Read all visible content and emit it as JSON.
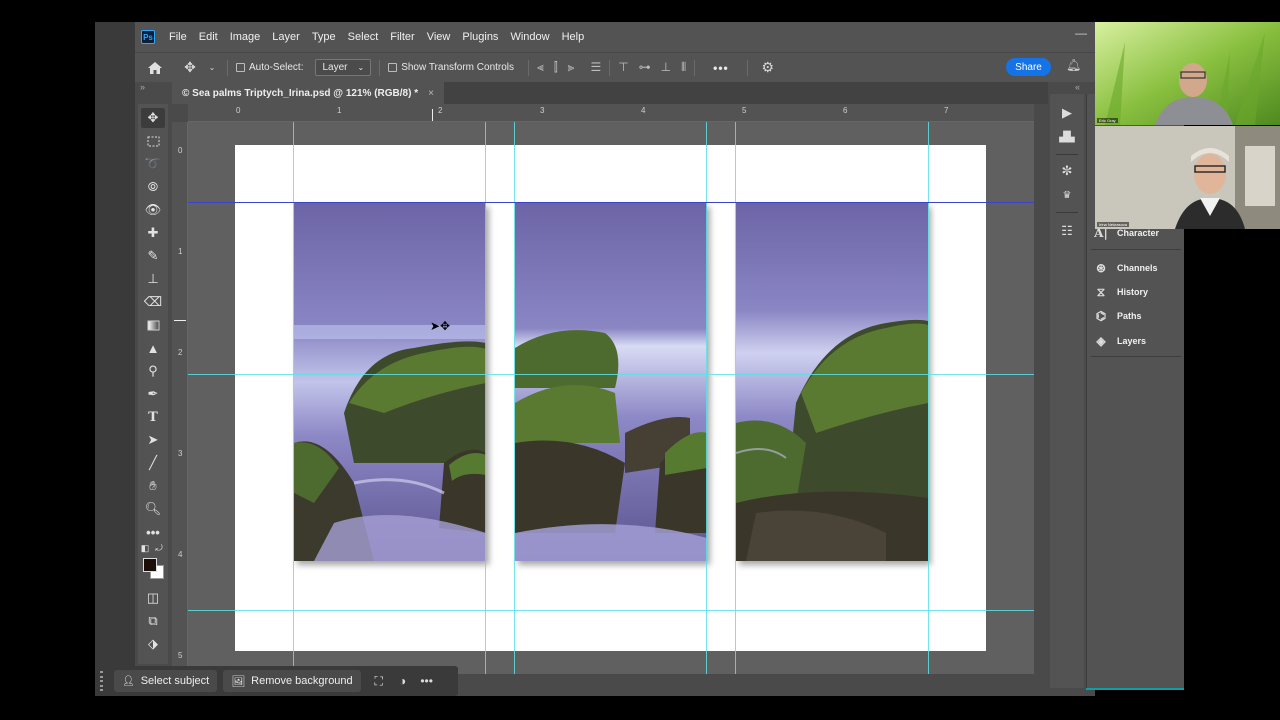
{
  "app": {
    "logo": "Ps",
    "menu": [
      "File",
      "Edit",
      "Image",
      "Layer",
      "Type",
      "Select",
      "Filter",
      "View",
      "Plugins",
      "Window",
      "Help"
    ]
  },
  "options": {
    "auto_select_label": "Auto-Select:",
    "auto_select_value": "Layer",
    "show_transform_label": "Show Transform Controls",
    "more_label": "•••",
    "share_label": "Share"
  },
  "document": {
    "tab_title": "© Sea palms Triptych_Irina.psd @ 121% (RGB/8) *",
    "close_glyph": "×"
  },
  "rulers": {
    "top": [
      "0",
      "1",
      "2",
      "3",
      "4",
      "5",
      "6",
      "7"
    ],
    "left": [
      "0",
      "1",
      "2",
      "3",
      "4",
      "5"
    ]
  },
  "panels": {
    "items": [
      {
        "label": "Character",
        "icon": "character-icon"
      },
      {
        "label": "Channels",
        "icon": "channels-icon"
      },
      {
        "label": "History",
        "icon": "history-icon"
      },
      {
        "label": "Paths",
        "icon": "paths-icon"
      },
      {
        "label": "Layers",
        "icon": "layers-icon"
      }
    ]
  },
  "contextual_bar": {
    "select_subject": "Select subject",
    "remove_background": "Remove background",
    "more": "•••"
  },
  "video": {
    "participant_1": "Eric Gray",
    "participant_2": "Irina Nekrasova"
  },
  "colors": {
    "accent": "#1473e6",
    "guide": "#5ce0e6",
    "foreground_swatch": "#1a0d0a",
    "background_swatch": "#ffffff"
  }
}
